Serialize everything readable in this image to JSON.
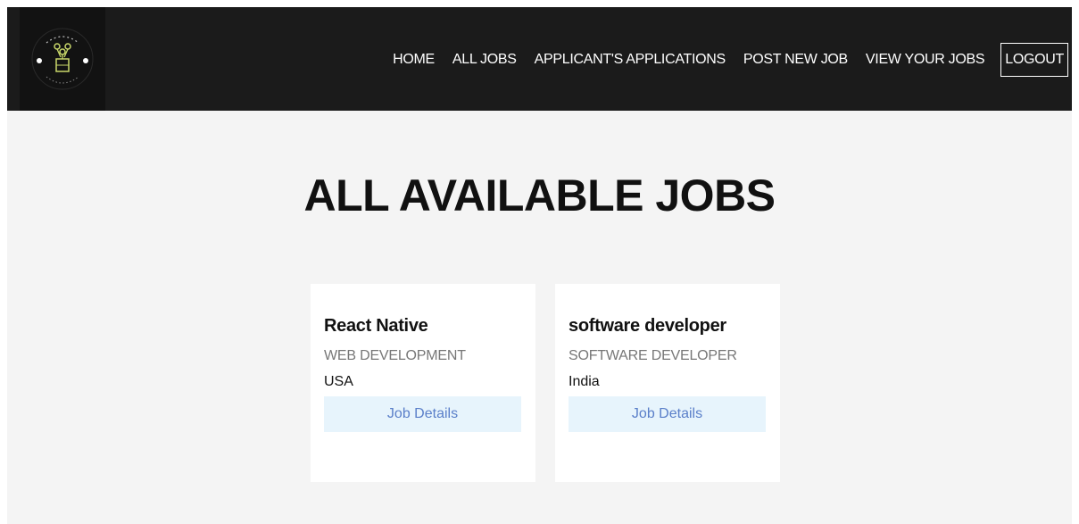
{
  "nav": {
    "links": [
      {
        "label": "HOME"
      },
      {
        "label": "ALL JOBS"
      },
      {
        "label": "APPLICANT'S APPLICATIONS"
      },
      {
        "label": "POST NEW JOB"
      },
      {
        "label": "VIEW YOUR JOBS"
      }
    ],
    "logout_label": "LOGOUT"
  },
  "main": {
    "title": "ALL AVAILABLE JOBS",
    "jobs": [
      {
        "title": "React Native",
        "category": "WEB DEVELOPMENT",
        "location": "USA",
        "button_label": "Job Details"
      },
      {
        "title": "software developer",
        "category": "SOFTWARE DEVELOPER",
        "location": "India",
        "button_label": "Job Details"
      }
    ]
  },
  "colors": {
    "navbar_bg": "#1b1b1b",
    "page_bg": "#f4f4f4",
    "button_bg": "#e7f4fc",
    "button_text": "#5a7fc9",
    "logo_accent": "#c9d86a"
  },
  "icons": {
    "logo": "peekajob-logo-icon"
  }
}
